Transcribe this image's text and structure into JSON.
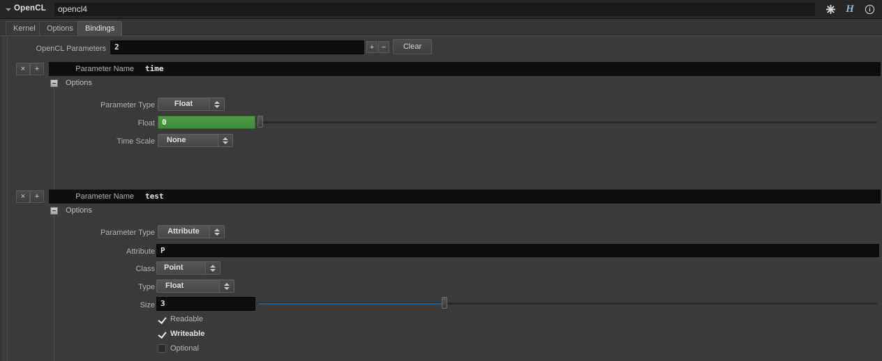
{
  "titlebar": {
    "node_type_label": "OpenCL",
    "node_name": "opencl4",
    "icons": {
      "gear": "gear-icon",
      "houdini": "H",
      "info": "info-icon"
    }
  },
  "tabs": [
    {
      "label": "Kernel",
      "active": false
    },
    {
      "label": "Options",
      "active": false
    },
    {
      "label": "Bindings",
      "active": true
    }
  ],
  "parameters_header": {
    "label": "OpenCL Parameters",
    "count": "2",
    "add_label": "+",
    "remove_label": "−",
    "clear_label": "Clear"
  },
  "multiparm_buttons": {
    "remove": "×",
    "insert": "+"
  },
  "instances": [
    {
      "name_label": "Parameter Name",
      "name_value": "time",
      "options_group_label": "Options",
      "rows": [
        {
          "label": "Parameter Type",
          "kind": "menu",
          "value": "Float"
        },
        {
          "label": "Float",
          "kind": "green-slider",
          "value": "0"
        },
        {
          "label": "Time Scale",
          "kind": "menu",
          "value": "None"
        }
      ]
    },
    {
      "name_label": "Parameter Name",
      "name_value": "test",
      "options_group_label": "Options",
      "rows": [
        {
          "label": "Parameter Type",
          "kind": "menu",
          "value": "Attribute"
        },
        {
          "label": "Attribute",
          "kind": "text",
          "value": "P"
        },
        {
          "label": "Class",
          "kind": "menu",
          "value": "Point"
        },
        {
          "label": "Type",
          "kind": "menu",
          "value": "Float"
        },
        {
          "label": "Size",
          "kind": "slider",
          "value": "3"
        }
      ],
      "checkboxes": [
        {
          "label": "Readable",
          "checked": true,
          "bold": false
        },
        {
          "label": "Writeable",
          "checked": true,
          "bold": true
        },
        {
          "label": "Optional",
          "checked": false,
          "bold": false
        }
      ]
    }
  ],
  "colors": {
    "panel_bg": "#3b3b3b",
    "titlebar_bg": "#262626",
    "field_bg": "#0e0e0e",
    "green_value": "#4d9c45",
    "slider_blue": "#2b5f91",
    "accent_h": "#8fb8df"
  }
}
